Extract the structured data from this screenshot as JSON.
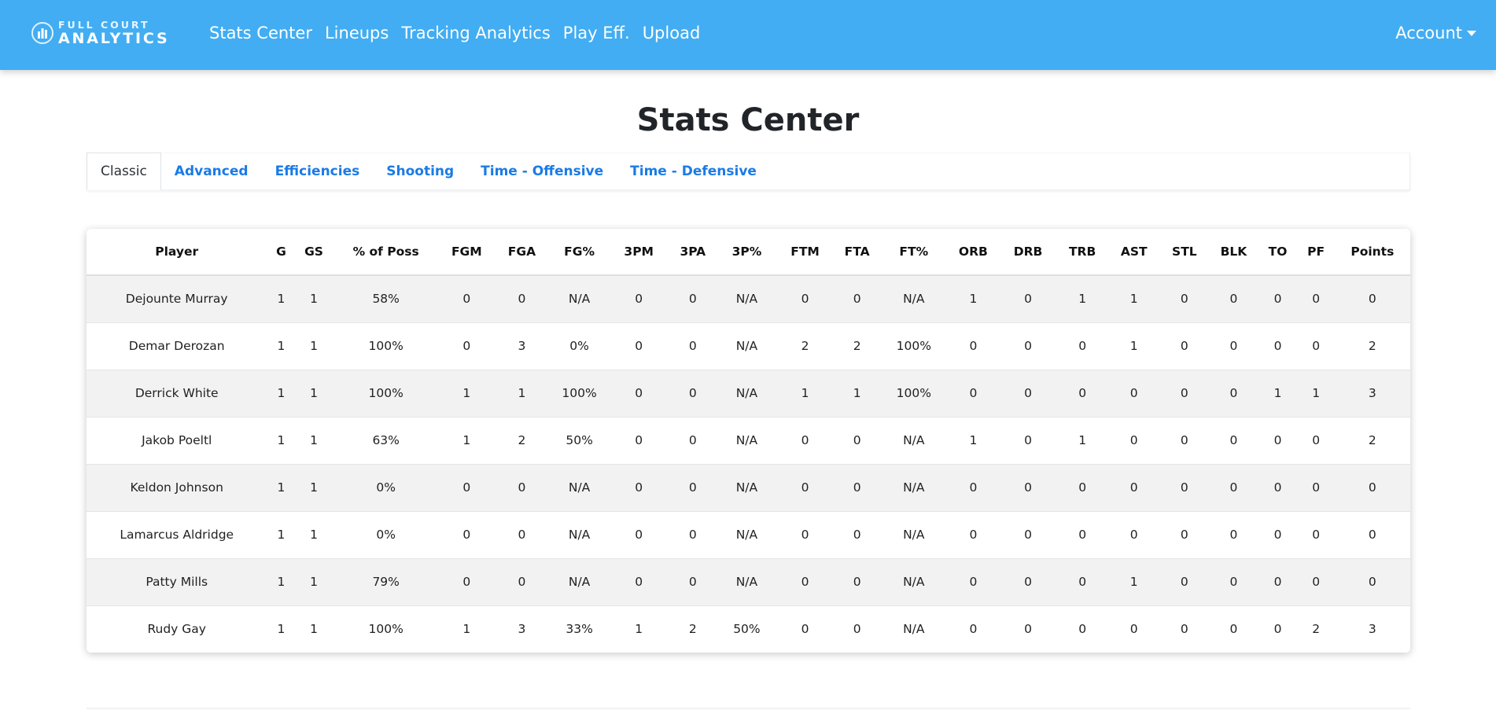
{
  "navbar": {
    "brand_top": "FULL COURT",
    "brand_bottom": "ANALYTICS",
    "links": [
      "Stats Center",
      "Lineups",
      "Tracking Analytics",
      "Play Eff.",
      "Upload"
    ],
    "account_label": "Account",
    "bg_color": "#42adf2"
  },
  "page_title": "Stats Center",
  "tabs": [
    "Classic",
    "Advanced",
    "Efficiencies",
    "Shooting",
    "Time - Offensive",
    "Time - Defensive"
  ],
  "active_tab": "Classic",
  "table": {
    "columns": [
      "Player",
      "G",
      "GS",
      "% of Poss",
      "FGM",
      "FGA",
      "FG%",
      "3PM",
      "3PA",
      "3P%",
      "FTM",
      "FTA",
      "FT%",
      "ORB",
      "DRB",
      "TRB",
      "AST",
      "STL",
      "BLK",
      "TO",
      "PF",
      "Points"
    ],
    "rows": [
      [
        "Dejounte Murray",
        "1",
        "1",
        "58%",
        "0",
        "0",
        "N/A",
        "0",
        "0",
        "N/A",
        "0",
        "0",
        "N/A",
        "1",
        "0",
        "1",
        "1",
        "0",
        "0",
        "0",
        "0",
        "0"
      ],
      [
        "Demar Derozan",
        "1",
        "1",
        "100%",
        "0",
        "3",
        "0%",
        "0",
        "0",
        "N/A",
        "2",
        "2",
        "100%",
        "0",
        "0",
        "0",
        "1",
        "0",
        "0",
        "0",
        "0",
        "2"
      ],
      [
        "Derrick White",
        "1",
        "1",
        "100%",
        "1",
        "1",
        "100%",
        "0",
        "0",
        "N/A",
        "1",
        "1",
        "100%",
        "0",
        "0",
        "0",
        "0",
        "0",
        "0",
        "1",
        "1",
        "3"
      ],
      [
        "Jakob Poeltl",
        "1",
        "1",
        "63%",
        "1",
        "2",
        "50%",
        "0",
        "0",
        "N/A",
        "0",
        "0",
        "N/A",
        "1",
        "0",
        "1",
        "0",
        "0",
        "0",
        "0",
        "0",
        "2"
      ],
      [
        "Keldon Johnson",
        "1",
        "1",
        "0%",
        "0",
        "0",
        "N/A",
        "0",
        "0",
        "N/A",
        "0",
        "0",
        "N/A",
        "0",
        "0",
        "0",
        "0",
        "0",
        "0",
        "0",
        "0",
        "0"
      ],
      [
        "Lamarcus Aldridge",
        "1",
        "1",
        "0%",
        "0",
        "0",
        "N/A",
        "0",
        "0",
        "N/A",
        "0",
        "0",
        "N/A",
        "0",
        "0",
        "0",
        "0",
        "0",
        "0",
        "0",
        "0",
        "0"
      ],
      [
        "Patty Mills",
        "1",
        "1",
        "79%",
        "0",
        "0",
        "N/A",
        "0",
        "0",
        "N/A",
        "0",
        "0",
        "N/A",
        "0",
        "0",
        "0",
        "1",
        "0",
        "0",
        "0",
        "0",
        "0"
      ],
      [
        "Rudy Gay",
        "1",
        "1",
        "100%",
        "1",
        "3",
        "33%",
        "1",
        "2",
        "50%",
        "0",
        "0",
        "N/A",
        "0",
        "0",
        "0",
        "0",
        "0",
        "0",
        "0",
        "2",
        "3"
      ]
    ]
  }
}
